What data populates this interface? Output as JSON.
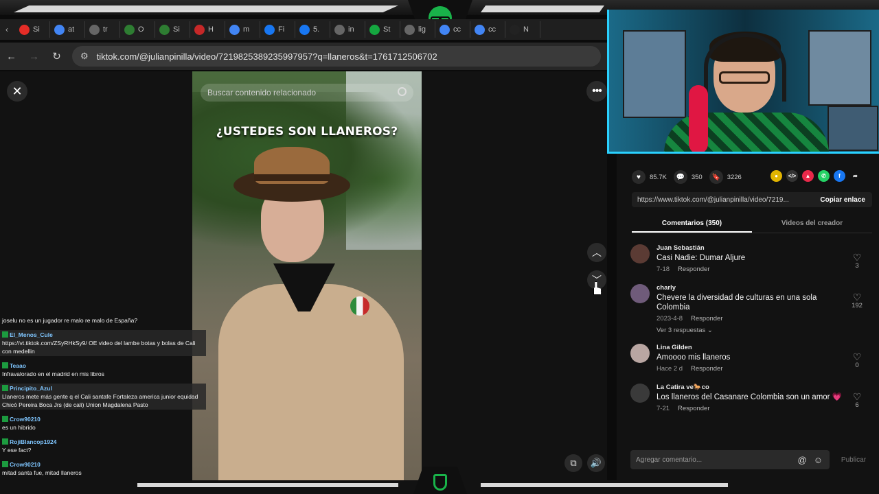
{
  "browser": {
    "tabs": [
      {
        "icon": "youtube-icon",
        "label": "Si",
        "color": "#e52d27"
      },
      {
        "icon": "google-icon",
        "label": "at",
        "color": "#4285f4"
      },
      {
        "icon": "globe-icon",
        "label": "tr",
        "color": "#666666"
      },
      {
        "icon": "fr-icon",
        "label": "O",
        "color": "#2e7d32"
      },
      {
        "icon": "fr-icon",
        "label": "Si",
        "color": "#2e7d32"
      },
      {
        "icon": "red-icon",
        "label": "H",
        "color": "#c62828"
      },
      {
        "icon": "google-icon",
        "label": "m",
        "color": "#4285f4"
      },
      {
        "icon": "facebook-icon",
        "label": "Fi",
        "color": "#1877f2"
      },
      {
        "icon": "facebook-icon",
        "label": "5.",
        "color": "#1877f2"
      },
      {
        "icon": "globe-icon",
        "label": "in",
        "color": "#666666"
      },
      {
        "icon": "kick-icon",
        "label": "St",
        "color": "#15a740"
      },
      {
        "icon": "globe-icon",
        "label": "lig",
        "color": "#666666"
      },
      {
        "icon": "google-icon",
        "label": "cc",
        "color": "#4285f4"
      },
      {
        "icon": "google-icon",
        "label": "cc",
        "color": "#4285f4"
      },
      {
        "icon": "x-icon",
        "label": "N",
        "color": "#222222"
      }
    ],
    "url": "tiktok.com/@julianpinilla/video/7219825389235997957?q=llaneros&t=1761712506702"
  },
  "video": {
    "search_placeholder": "Buscar contenido relacionado",
    "caption": "¿USTEDES SON LLANEROS?"
  },
  "actions": {
    "likes": "85.7K",
    "comments": "350",
    "saves": "3226"
  },
  "share_icons": [
    {
      "icon": "coin-icon",
      "color": "#e2b400",
      "glyph": "●"
    },
    {
      "icon": "embed-icon",
      "color": "#333333",
      "glyph": "</>"
    },
    {
      "icon": "send-icon",
      "color": "#e8294a",
      "glyph": "▲"
    },
    {
      "icon": "whatsapp-icon",
      "color": "#25d366",
      "glyph": "✆"
    },
    {
      "icon": "facebook-icon",
      "color": "#1877f2",
      "glyph": "f"
    },
    {
      "icon": "forward-icon",
      "color": "#121212",
      "glyph": "➦"
    }
  ],
  "link": {
    "url": "https://www.tiktok.com/@julianpinilla/video/7219...",
    "copy_label": "Copiar enlace"
  },
  "tabs": {
    "comments": "Comentarios (350)",
    "creator_videos": "Videos del creador"
  },
  "comments": [
    {
      "name": "Juan Sebastián",
      "text": "Casi Nadie: Dumar Aljure",
      "date": "7-18",
      "reply": "Responder",
      "likes": "3",
      "avatar_color": "#5b3b34"
    },
    {
      "name": "charly",
      "text": "Chevere la diversidad de culturas en una sola Colombia",
      "date": "2023-4-8",
      "reply": "Responder",
      "likes": "192",
      "replies": "Ver 3 respuestas ⌄",
      "avatar_color": "#6f5b7a"
    },
    {
      "name": "Lina Gilden",
      "text": "Amoooo mis llaneros",
      "date": "Hace 2 d",
      "reply": "Responder",
      "likes": "0",
      "avatar_color": "#b9a6a2"
    },
    {
      "name": "La Catira ve🐎co",
      "text": "Los llaneros del Casanare Colombia son un amor 💗",
      "date": "7-21",
      "reply": "Responder",
      "likes": "6",
      "avatar_color": "#3a3a3a"
    }
  ],
  "comment_box": {
    "placeholder": "Agregar comentario...",
    "publish": "Publicar"
  },
  "chat": [
    {
      "user": "",
      "text": "joselu no es un jugador re malo re malo de España?"
    },
    {
      "user": "El_Menos_Cule",
      "text": "https://vt.tiktok.com/ZSyRHkSy9/ OE video del lambe botas y bolas de Cali con medellin"
    },
    {
      "user": "Teaao",
      "text": "Infravalorado en el madrid en mis libros"
    },
    {
      "user": "Principito_Azul",
      "text": "Llaneros mete más gente q el Cali santafe Fortaleza america junior equidad Chicó Pereira Boca Jrs (de cali) Union Magdalena Pasto"
    },
    {
      "user": "Crow90210",
      "text": "es un hibrido"
    },
    {
      "user": "RojiBlancop1924",
      "text": "Y ese fact?"
    },
    {
      "user": "Crow90210",
      "text": "mitad santa fue, mitad llaneros"
    }
  ]
}
